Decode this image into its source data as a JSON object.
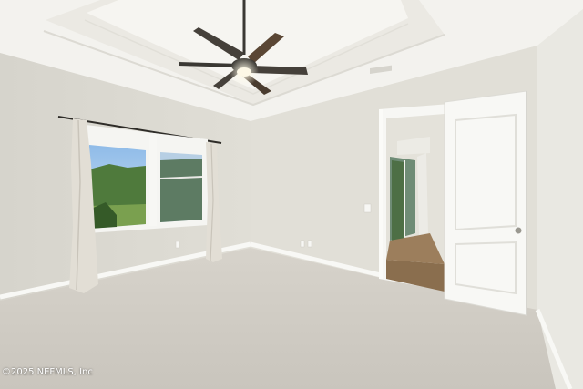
{
  "photo": {
    "watermark": "©2025 NEFMLS, Inc",
    "subject": [
      "empty-bedroom",
      "ceiling-fan",
      "tray-ceiling",
      "window-with-curtains",
      "open-door",
      "hallway",
      "carpet-floor"
    ]
  },
  "colors": {
    "ceiling": "#f4f3ef",
    "wall_left": "#dddbd3",
    "wall_back": "#e2e0d8",
    "wall_right": "#e9e8e2",
    "carpet": "#cfcbc3",
    "trim": "#fafaf7",
    "door": "#f7f7f4",
    "fan": "#3a3833",
    "hall_floor": "#8a6e4e",
    "outdoor_green": "#4f7a3c",
    "sky": "#9cc3ea"
  }
}
